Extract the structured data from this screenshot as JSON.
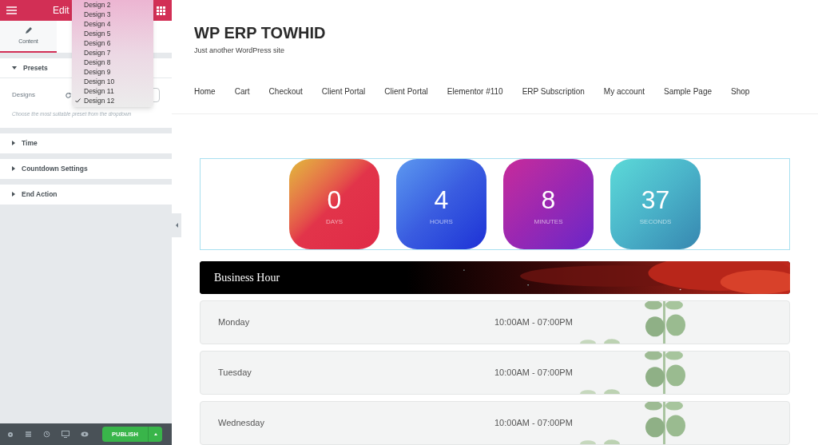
{
  "editor": {
    "header_title": "Edit",
    "tabs": [
      {
        "label": "Content",
        "selected": true
      }
    ],
    "sections": [
      {
        "title": "Presets",
        "expanded": true,
        "field": {
          "label": "Designs",
          "help": "Choose the most suitable preset from the dropdown"
        }
      },
      {
        "title": "Time",
        "expanded": false
      },
      {
        "title": "Countdown Settings",
        "expanded": false
      },
      {
        "title": "End Action",
        "expanded": false
      }
    ],
    "dropdown": [
      {
        "label": "Design 2",
        "selected": false
      },
      {
        "label": "Design 3",
        "selected": false
      },
      {
        "label": "Design 4",
        "selected": false
      },
      {
        "label": "Design 5",
        "selected": false
      },
      {
        "label": "Design 6",
        "selected": false
      },
      {
        "label": "Design 7",
        "selected": false
      },
      {
        "label": "Design 8",
        "selected": false
      },
      {
        "label": "Design 9",
        "selected": false
      },
      {
        "label": "Design 10",
        "selected": false
      },
      {
        "label": "Design 11",
        "selected": false
      },
      {
        "label": "Design 12",
        "selected": true
      }
    ],
    "publish": "PUBLISH"
  },
  "site": {
    "title": "WP ERP TOWHID",
    "tagline": "Just another WordPress site",
    "nav": [
      "Home",
      "Cart",
      "Checkout",
      "Client Portal",
      "Client Portal",
      "Elementor #110",
      "ERP Subscription",
      "My account",
      "Sample Page",
      "Shop"
    ]
  },
  "countdown": [
    {
      "value": "0",
      "unit": "DAYS",
      "color": "#e22d46"
    },
    {
      "value": "4",
      "unit": "HOURS",
      "color": "#2f4fdc"
    },
    {
      "value": "8",
      "unit": "MINUTES",
      "color": "#9a27b2"
    },
    {
      "value": "37",
      "unit": "SECONDS",
      "color": "#4ab3c9"
    }
  ],
  "business_hours": {
    "title": "Business Hour",
    "rows": [
      {
        "day": "Monday",
        "hours": "10:00AM - 07:00PM"
      },
      {
        "day": "Tuesday",
        "hours": "10:00AM - 07:00PM"
      },
      {
        "day": "Wednesday",
        "hours": "10:00AM - 07:00PM"
      }
    ]
  }
}
